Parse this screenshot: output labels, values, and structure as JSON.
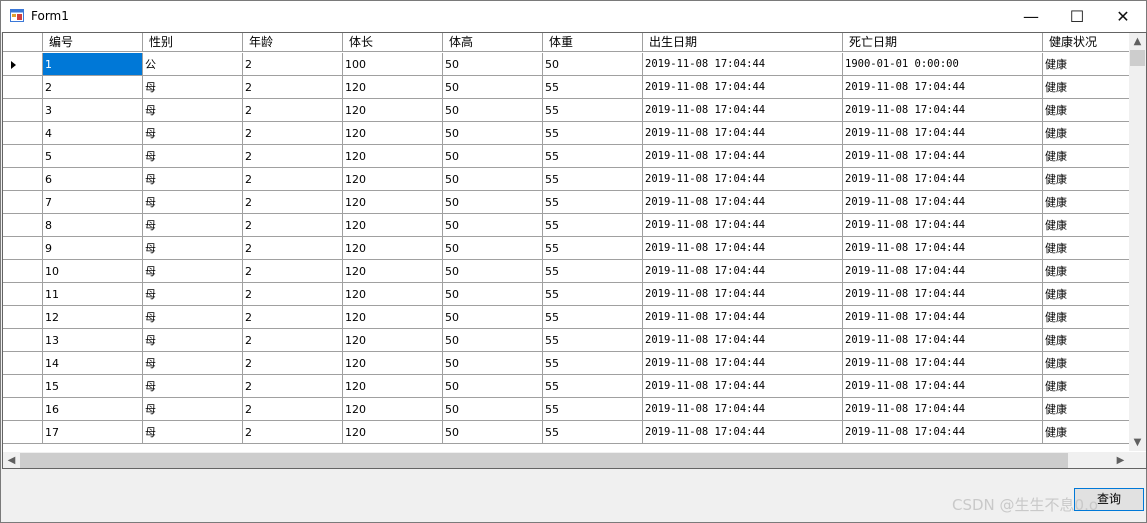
{
  "window": {
    "title": "Form1",
    "minimize_glyph": "—",
    "maximize_glyph": "☐",
    "close_glyph": "✕"
  },
  "grid": {
    "columns": [
      "编号",
      "性别",
      "年龄",
      "体长",
      "体高",
      "体重",
      "出生日期",
      "死亡日期",
      "健康状况"
    ],
    "rows": [
      [
        "1",
        "公",
        "2",
        "100",
        "50",
        "50",
        "2019-11-08 17:04:44",
        "1900-01-01 0:00:00",
        "健康"
      ],
      [
        "2",
        "母",
        "2",
        "120",
        "50",
        "55",
        "2019-11-08 17:04:44",
        "2019-11-08 17:04:44",
        "健康"
      ],
      [
        "3",
        "母",
        "2",
        "120",
        "50",
        "55",
        "2019-11-08 17:04:44",
        "2019-11-08 17:04:44",
        "健康"
      ],
      [
        "4",
        "母",
        "2",
        "120",
        "50",
        "55",
        "2019-11-08 17:04:44",
        "2019-11-08 17:04:44",
        "健康"
      ],
      [
        "5",
        "母",
        "2",
        "120",
        "50",
        "55",
        "2019-11-08 17:04:44",
        "2019-11-08 17:04:44",
        "健康"
      ],
      [
        "6",
        "母",
        "2",
        "120",
        "50",
        "55",
        "2019-11-08 17:04:44",
        "2019-11-08 17:04:44",
        "健康"
      ],
      [
        "7",
        "母",
        "2",
        "120",
        "50",
        "55",
        "2019-11-08 17:04:44",
        "2019-11-08 17:04:44",
        "健康"
      ],
      [
        "8",
        "母",
        "2",
        "120",
        "50",
        "55",
        "2019-11-08 17:04:44",
        "2019-11-08 17:04:44",
        "健康"
      ],
      [
        "9",
        "母",
        "2",
        "120",
        "50",
        "55",
        "2019-11-08 17:04:44",
        "2019-11-08 17:04:44",
        "健康"
      ],
      [
        "10",
        "母",
        "2",
        "120",
        "50",
        "55",
        "2019-11-08 17:04:44",
        "2019-11-08 17:04:44",
        "健康"
      ],
      [
        "11",
        "母",
        "2",
        "120",
        "50",
        "55",
        "2019-11-08 17:04:44",
        "2019-11-08 17:04:44",
        "健康"
      ],
      [
        "12",
        "母",
        "2",
        "120",
        "50",
        "55",
        "2019-11-08 17:04:44",
        "2019-11-08 17:04:44",
        "健康"
      ],
      [
        "13",
        "母",
        "2",
        "120",
        "50",
        "55",
        "2019-11-08 17:04:44",
        "2019-11-08 17:04:44",
        "健康"
      ],
      [
        "14",
        "母",
        "2",
        "120",
        "50",
        "55",
        "2019-11-08 17:04:44",
        "2019-11-08 17:04:44",
        "健康"
      ],
      [
        "15",
        "母",
        "2",
        "120",
        "50",
        "55",
        "2019-11-08 17:04:44",
        "2019-11-08 17:04:44",
        "健康"
      ],
      [
        "16",
        "母",
        "2",
        "120",
        "50",
        "55",
        "2019-11-08 17:04:44",
        "2019-11-08 17:04:44",
        "健康"
      ],
      [
        "17",
        "母",
        "2",
        "120",
        "50",
        "55",
        "2019-11-08 17:04:44",
        "2019-11-08 17:04:44",
        "健康"
      ]
    ],
    "selected_row": 0,
    "selection_color": "#0078d7"
  },
  "query_button": {
    "label": "查询"
  },
  "watermark": "CSDN @生生不息0.o",
  "icons": {
    "app": "form-icon",
    "scroll_up": "▲",
    "scroll_down": "▼",
    "scroll_left": "◀",
    "scroll_right": "▶"
  }
}
